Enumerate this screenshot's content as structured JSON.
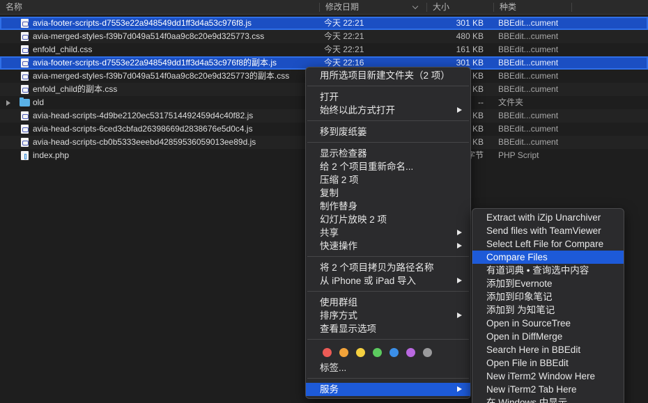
{
  "header": {
    "col_name": "名称",
    "col_date": "修改日期",
    "col_size": "大小",
    "col_kind": "种类"
  },
  "files": [
    {
      "name": "avia-footer-scripts-d7553e22a948549dd1ff3d4a53c976f8.js",
      "date": "今天 22:21",
      "size": "301 KB",
      "kind": "BBEdit...cument",
      "icon": "js-file-icon",
      "selected": true
    },
    {
      "name": "avia-merged-styles-f39b7d049a514f0aa9c8c20e9d325773.css",
      "date": "今天 22:21",
      "size": "480 KB",
      "kind": "BBEdit...cument",
      "icon": "css-file-icon",
      "selected": false
    },
    {
      "name": "enfold_child.css",
      "date": "今天 22:21",
      "size": "161 KB",
      "kind": "BBEdit...cument",
      "icon": "css-file-icon",
      "selected": false
    },
    {
      "name": "avia-footer-scripts-d7553e22a948549dd1ff3d4a53c976f8的副本.js",
      "date": "今天 22:16",
      "size": "301 KB",
      "kind": "BBEdit...cument",
      "icon": "js-file-icon",
      "selected": true
    },
    {
      "name": "avia-merged-styles-f39b7d049a514f0aa9c8c20e9d325773的副本.css",
      "date": "",
      "size": "KB",
      "kind": "BBEdit...cument",
      "icon": "css-file-icon",
      "selected": false
    },
    {
      "name": "enfold_child的副本.css",
      "date": "",
      "size": "KB",
      "kind": "BBEdit...cument",
      "icon": "css-file-icon",
      "selected": false
    },
    {
      "name": "old",
      "date": "",
      "size": "--",
      "kind": "文件夹",
      "icon": "folder-icon",
      "selected": false,
      "folder": true
    },
    {
      "name": "avia-head-scripts-4d9be2120ec5317514492459d4c40f82.js",
      "date": "",
      "size": "KB",
      "kind": "BBEdit...cument",
      "icon": "js-file-icon",
      "selected": false
    },
    {
      "name": "avia-head-scripts-6ced3cbfad26398669d2838676e5d0c4.js",
      "date": "",
      "size": "KB",
      "kind": "BBEdit...cument",
      "icon": "js-file-icon",
      "selected": false
    },
    {
      "name": "avia-head-scripts-cb0b5333eeebd42859536059013ee89d.js",
      "date": "",
      "size": "KB",
      "kind": "BBEdit...cument",
      "icon": "js-file-icon",
      "selected": false
    },
    {
      "name": "index.php",
      "date": "",
      "size": "字节",
      "kind": "PHP Script",
      "icon": "php-file-icon",
      "selected": false
    }
  ],
  "context_menu": {
    "items": [
      {
        "label": "用所选项目新建文件夹（2 项）",
        "submenu": false
      },
      {
        "label": "打开",
        "submenu": false
      },
      {
        "label": "始终以此方式打开",
        "submenu": true
      },
      {
        "label": "移到废纸篓",
        "submenu": false
      },
      {
        "label": "显示检查器",
        "submenu": false
      },
      {
        "label": "给 2 个项目重新命名...",
        "submenu": false
      },
      {
        "label": "压缩 2 项",
        "submenu": false
      },
      {
        "label": "复制",
        "submenu": false
      },
      {
        "label": "制作替身",
        "submenu": false
      },
      {
        "label": "幻灯片放映 2 项",
        "submenu": false
      },
      {
        "label": "共享",
        "submenu": true
      },
      {
        "label": "快速操作",
        "submenu": true
      },
      {
        "label": "将 2 个项目拷贝为路径名称",
        "submenu": false
      },
      {
        "label": "从 iPhone 或 iPad 导入",
        "submenu": true
      },
      {
        "label": "使用群组",
        "submenu": false
      },
      {
        "label": "排序方式",
        "submenu": true
      },
      {
        "label": "查看显示选项",
        "submenu": false
      },
      {
        "label": "标签...",
        "submenu": false
      },
      {
        "label": "服务",
        "submenu": true,
        "highlighted": true
      }
    ],
    "tag_colors": [
      "#ec5b56",
      "#f2a33a",
      "#f5d040",
      "#5ccb5f",
      "#3b8fe8",
      "#b968e0",
      "#9a9a9c"
    ]
  },
  "services_menu": {
    "items": [
      "Extract with iZip Unarchiver",
      "Send files with TeamViewer",
      "Select Left File for Compare",
      "Compare Files",
      "有道词典 • 查询选中内容",
      "添加到Evernote",
      "添加到印象笔记",
      "添加到 为知笔记",
      "Open in SourceTree",
      "Open in DiffMerge",
      "Search Here in BBEdit",
      "Open File in BBEdit",
      "New iTerm2 Window Here",
      "New iTerm2 Tab Here",
      "在 Windows 中显示"
    ],
    "highlighted": "Compare Files"
  },
  "colors": {
    "selection": "#1b4fc3",
    "menu_highlight": "#1d5ad8",
    "background": "#1e1e1e"
  }
}
